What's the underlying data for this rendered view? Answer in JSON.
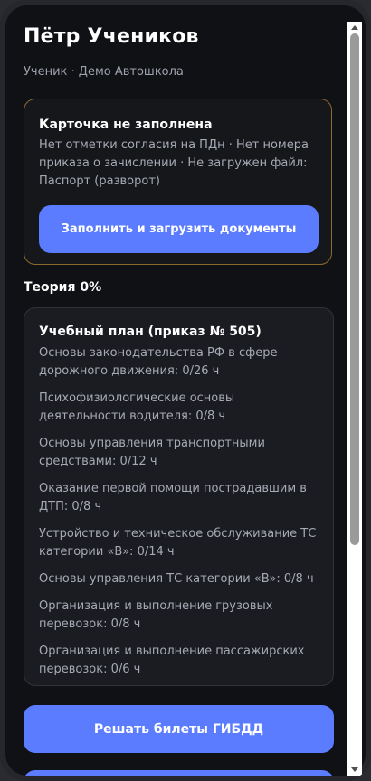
{
  "profile": {
    "name": "Пётр Учеников",
    "subtitle": "Ученик · Демо Автошкола"
  },
  "alert": {
    "title": "Карточка не заполнена",
    "text": "Нет отметки согласия на ПДн · Нет номера приказа о зачислении · Не загружен файл: Паспорт (разворот)",
    "button_label": "Заполнить и загрузить документы"
  },
  "theory": {
    "label": "Теория 0%",
    "progress_percent": 0
  },
  "plan": {
    "title": "Учебный план (приказ № 505)",
    "items": [
      "Основы законодательства РФ в сфере дорожного движения: 0/26 ч",
      "Психофизиологические основы деятельности водителя: 0/8 ч",
      "Основы управления транспортными средствами: 0/12 ч",
      "Оказание первой помощи пострадавшим в ДТП: 0/8 ч",
      "Устройство и техническое обслуживание ТС категории «B»: 0/14 ч",
      "Основы управления ТС категории «B»: 0/8 ч",
      "Организация и выполнение грузовых перевозок: 0/8 ч",
      "Организация и выполнение пассажирских перевозок: 0/6 ч"
    ]
  },
  "actions": {
    "tickets_label": "Решать билеты ГИБДД"
  },
  "colors": {
    "accent": "#5b7cff",
    "warning_border": "#8a6a2b",
    "background": "#101114",
    "card": "#1b1c22"
  }
}
